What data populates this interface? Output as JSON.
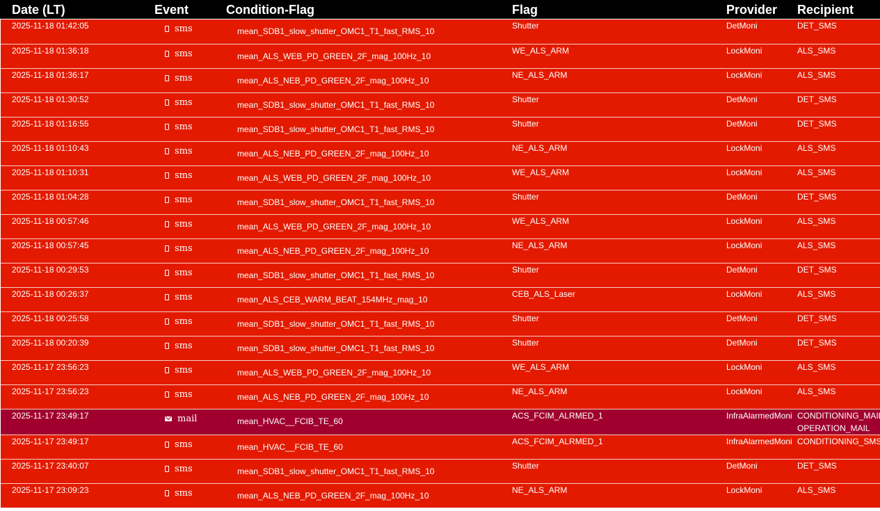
{
  "colors": {
    "header_bg": "#000000",
    "sms_row_bg": "#e31a00",
    "mail_row_bg": "#a1002e",
    "text": "#ffffff"
  },
  "columns": {
    "date": "Date (LT)",
    "event": "Event",
    "condition_flag": "Condition-Flag",
    "flag": "Flag",
    "provider": "Provider",
    "recipient": "Recipient"
  },
  "rows": [
    {
      "date": "2025-11-18 01:42:05",
      "event": "sms",
      "icon": "phone-icon",
      "condition": "mean_SDB1_slow_shutter_OMC1_T1_fast_RMS_10",
      "flag": "Shutter",
      "provider": "DetMoni",
      "recipient": [
        "DET_SMS"
      ]
    },
    {
      "date": "2025-11-18 01:36:18",
      "event": "sms",
      "icon": "phone-icon",
      "condition": "mean_ALS_WEB_PD_GREEN_2F_mag_100Hz_10",
      "flag": "WE_ALS_ARM",
      "provider": "LockMoni",
      "recipient": [
        "ALS_SMS"
      ]
    },
    {
      "date": "2025-11-18 01:36:17",
      "event": "sms",
      "icon": "phone-icon",
      "condition": "mean_ALS_NEB_PD_GREEN_2F_mag_100Hz_10",
      "flag": "NE_ALS_ARM",
      "provider": "LockMoni",
      "recipient": [
        "ALS_SMS"
      ]
    },
    {
      "date": "2025-11-18 01:30:52",
      "event": "sms",
      "icon": "phone-icon",
      "condition": "mean_SDB1_slow_shutter_OMC1_T1_fast_RMS_10",
      "flag": "Shutter",
      "provider": "DetMoni",
      "recipient": [
        "DET_SMS"
      ]
    },
    {
      "date": "2025-11-18 01:16:55",
      "event": "sms",
      "icon": "phone-icon",
      "condition": "mean_SDB1_slow_shutter_OMC1_T1_fast_RMS_10",
      "flag": "Shutter",
      "provider": "DetMoni",
      "recipient": [
        "DET_SMS"
      ]
    },
    {
      "date": "2025-11-18 01:10:43",
      "event": "sms",
      "icon": "phone-icon",
      "condition": "mean_ALS_NEB_PD_GREEN_2F_mag_100Hz_10",
      "flag": "NE_ALS_ARM",
      "provider": "LockMoni",
      "recipient": [
        "ALS_SMS"
      ]
    },
    {
      "date": "2025-11-18 01:10:31",
      "event": "sms",
      "icon": "phone-icon",
      "condition": "mean_ALS_WEB_PD_GREEN_2F_mag_100Hz_10",
      "flag": "WE_ALS_ARM",
      "provider": "LockMoni",
      "recipient": [
        "ALS_SMS"
      ]
    },
    {
      "date": "2025-11-18 01:04:28",
      "event": "sms",
      "icon": "phone-icon",
      "condition": "mean_SDB1_slow_shutter_OMC1_T1_fast_RMS_10",
      "flag": "Shutter",
      "provider": "DetMoni",
      "recipient": [
        "DET_SMS"
      ]
    },
    {
      "date": "2025-11-18 00:57:46",
      "event": "sms",
      "icon": "phone-icon",
      "condition": "mean_ALS_WEB_PD_GREEN_2F_mag_100Hz_10",
      "flag": "WE_ALS_ARM",
      "provider": "LockMoni",
      "recipient": [
        "ALS_SMS"
      ]
    },
    {
      "date": "2025-11-18 00:57:45",
      "event": "sms",
      "icon": "phone-icon",
      "condition": "mean_ALS_NEB_PD_GREEN_2F_mag_100Hz_10",
      "flag": "NE_ALS_ARM",
      "provider": "LockMoni",
      "recipient": [
        "ALS_SMS"
      ]
    },
    {
      "date": "2025-11-18 00:29:53",
      "event": "sms",
      "icon": "phone-icon",
      "condition": "mean_SDB1_slow_shutter_OMC1_T1_fast_RMS_10",
      "flag": "Shutter",
      "provider": "DetMoni",
      "recipient": [
        "DET_SMS"
      ]
    },
    {
      "date": "2025-11-18 00:26:37",
      "event": "sms",
      "icon": "phone-icon",
      "condition": "mean_ALS_CEB_WARM_BEAT_154MHz_mag_10",
      "flag": "CEB_ALS_Laser",
      "provider": "LockMoni",
      "recipient": [
        "ALS_SMS"
      ]
    },
    {
      "date": "2025-11-18 00:25:58",
      "event": "sms",
      "icon": "phone-icon",
      "condition": "mean_SDB1_slow_shutter_OMC1_T1_fast_RMS_10",
      "flag": "Shutter",
      "provider": "DetMoni",
      "recipient": [
        "DET_SMS"
      ]
    },
    {
      "date": "2025-11-18 00:20:39",
      "event": "sms",
      "icon": "phone-icon",
      "condition": "mean_SDB1_slow_shutter_OMC1_T1_fast_RMS_10",
      "flag": "Shutter",
      "provider": "DetMoni",
      "recipient": [
        "DET_SMS"
      ]
    },
    {
      "date": "2025-11-17 23:56:23",
      "event": "sms",
      "icon": "phone-icon",
      "condition": "mean_ALS_WEB_PD_GREEN_2F_mag_100Hz_10",
      "flag": "WE_ALS_ARM",
      "provider": "LockMoni",
      "recipient": [
        "ALS_SMS"
      ]
    },
    {
      "date": "2025-11-17 23:56:23",
      "event": "sms",
      "icon": "phone-icon",
      "condition": "mean_ALS_NEB_PD_GREEN_2F_mag_100Hz_10",
      "flag": "NE_ALS_ARM",
      "provider": "LockMoni",
      "recipient": [
        "ALS_SMS"
      ]
    },
    {
      "date": "2025-11-17 23:49:17",
      "event": "mail",
      "icon": "mail-icon",
      "condition": "mean_HVAC__FCIB_TE_60",
      "flag": "ACS_FCIM_ALRMED_1",
      "provider": "InfraAlarmedMoni",
      "recipient": [
        "CONDITIONING_MAIL",
        "OPERATION_MAIL"
      ]
    },
    {
      "date": "2025-11-17 23:49:17",
      "event": "sms",
      "icon": "phone-icon",
      "condition": "mean_HVAC__FCIB_TE_60",
      "flag": "ACS_FCIM_ALRMED_1",
      "provider": "InfraAlarmedMoni",
      "recipient": [
        "CONDITIONING_SMS"
      ]
    },
    {
      "date": "2025-11-17 23:40:07",
      "event": "sms",
      "icon": "phone-icon",
      "condition": "mean_SDB1_slow_shutter_OMC1_T1_fast_RMS_10",
      "flag": "Shutter",
      "provider": "DetMoni",
      "recipient": [
        "DET_SMS"
      ]
    },
    {
      "date": "2025-11-17 23:09:23",
      "event": "sms",
      "icon": "phone-icon",
      "condition": "mean_ALS_NEB_PD_GREEN_2F_mag_100Hz_10",
      "flag": "NE_ALS_ARM",
      "provider": "LockMoni",
      "recipient": [
        "ALS_SMS"
      ]
    }
  ]
}
